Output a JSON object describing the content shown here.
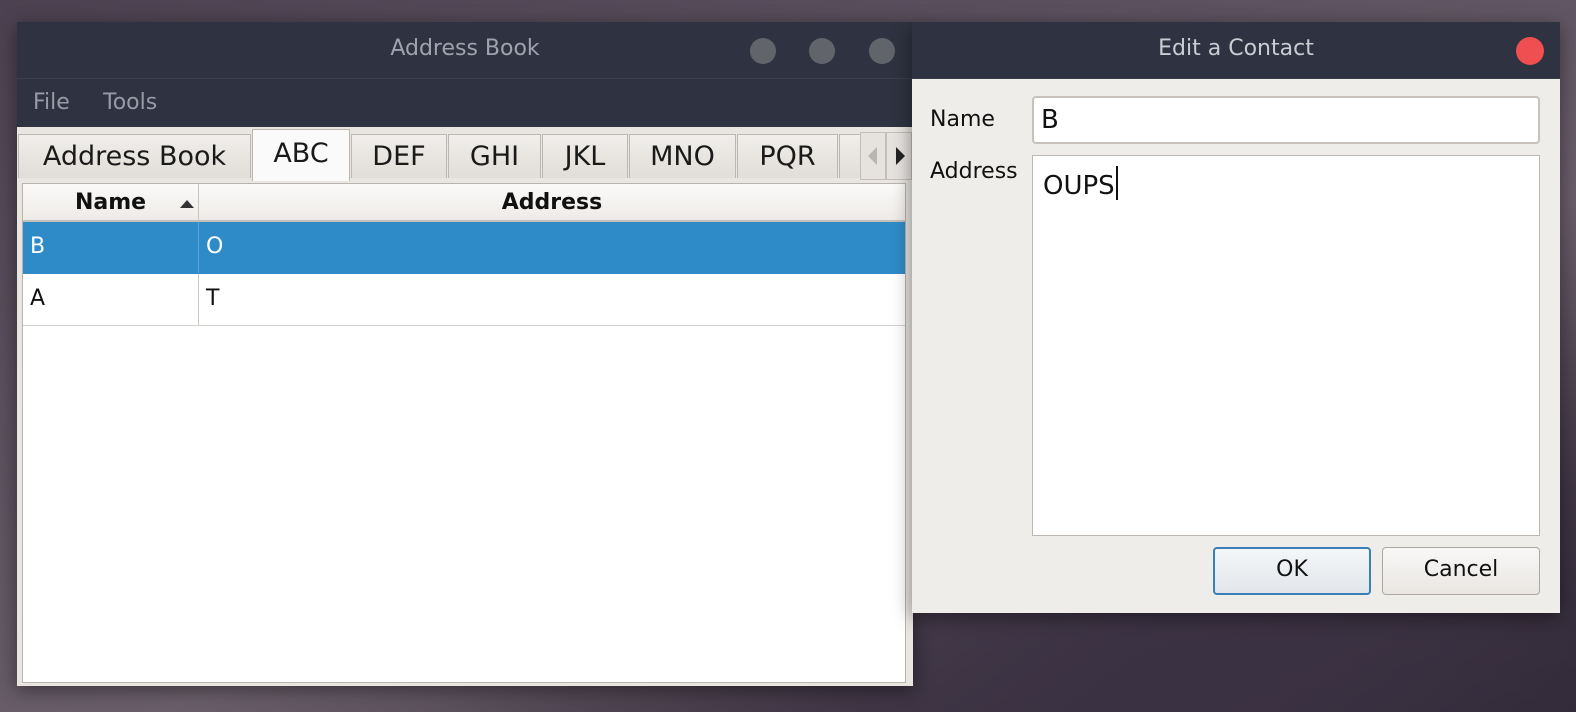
{
  "main_window": {
    "title": "Address Book",
    "menu": [
      "File",
      "Tools"
    ],
    "tabs": [
      "Address Book",
      "ABC",
      "DEF",
      "GHI",
      "JKL",
      "MNO",
      "PQR"
    ],
    "active_tab": "ABC",
    "table": {
      "columns": [
        "Name",
        "Address"
      ],
      "sort_column": "Name",
      "sort_direction": "ascending",
      "rows": [
        {
          "name": "B",
          "address": "O",
          "selected": true
        },
        {
          "name": "A",
          "address": "T",
          "selected": false
        }
      ]
    }
  },
  "dialog": {
    "title": "Edit a Contact",
    "name_label": "Name",
    "name_value": "B",
    "address_label": "Address",
    "address_value": "OUPS",
    "ok_label": "OK",
    "cancel_label": "Cancel"
  },
  "colors": {
    "titlebar": "#2f3341",
    "selection": "#2f8bc8",
    "close_button": "#ef4f51"
  }
}
